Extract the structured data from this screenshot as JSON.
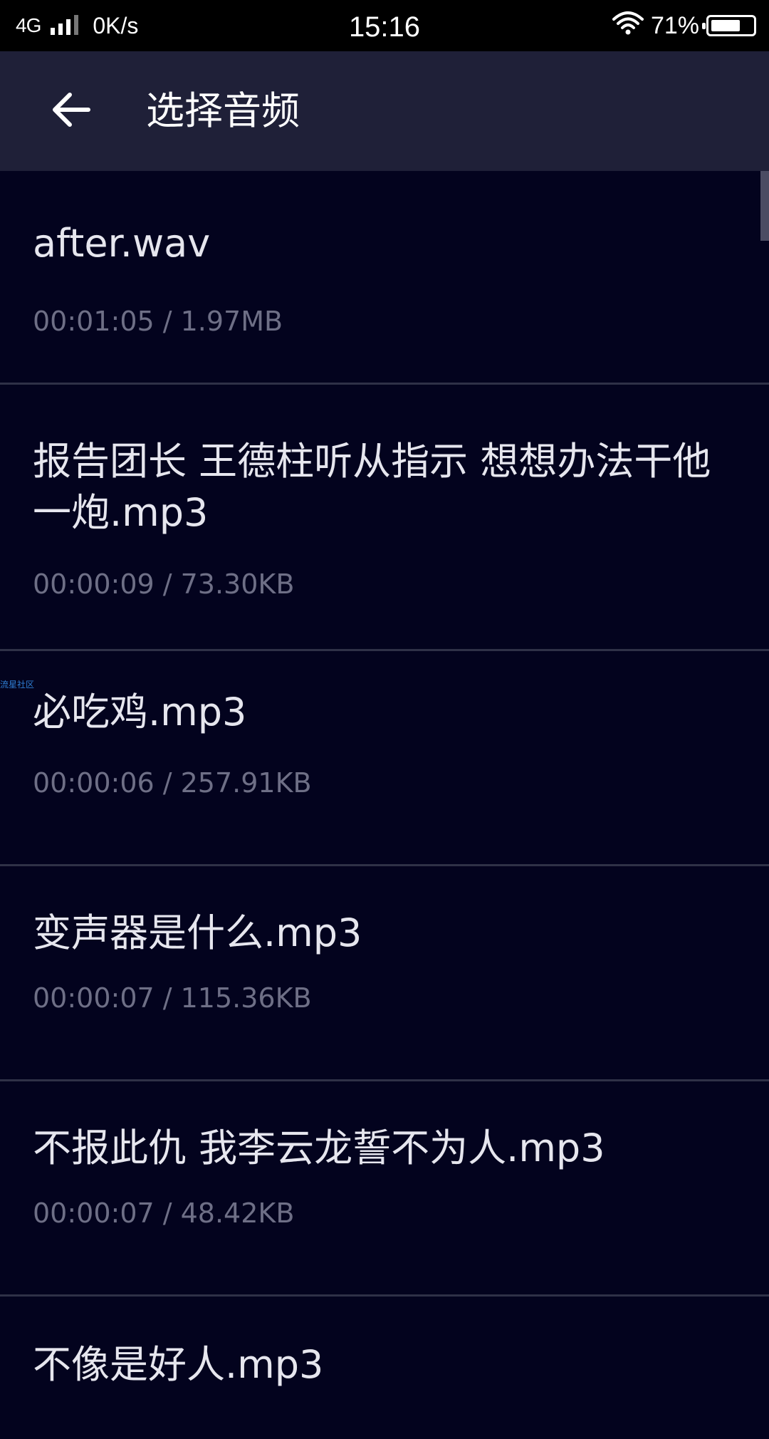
{
  "status_bar": {
    "network": "4G",
    "speed": "0K/s",
    "time": "15:16",
    "battery": "71%",
    "battery_level": 0.71,
    "icons": [
      "signal-icon",
      "wifi-icon",
      "battery-icon"
    ]
  },
  "toolbar": {
    "back_icon": "arrow-left-icon",
    "title": "选择音频"
  },
  "watermark": "流星社区",
  "files": [
    {
      "name": "after.wav",
      "meta": "00:01:05 / 1.97MB"
    },
    {
      "name": "报告团长 王德柱听从指示 想想办法干他一炮.mp3",
      "meta": "00:00:09 / 73.30KB"
    },
    {
      "name": "必吃鸡.mp3",
      "meta": "00:00:06 / 257.91KB"
    },
    {
      "name": "变声器是什么.mp3",
      "meta": "00:00:07 / 115.36KB"
    },
    {
      "name": "不报此仇 我李云龙誓不为人.mp3",
      "meta": "00:00:07 / 48.42KB"
    },
    {
      "name": "不像是好人.mp3",
      "meta": ""
    }
  ],
  "colors": {
    "background": "#03031e",
    "toolbar": "#1f2038",
    "primary_text": "#e6e6ee",
    "secondary_text": "#6e6f86",
    "divider": "#2f3147"
  }
}
